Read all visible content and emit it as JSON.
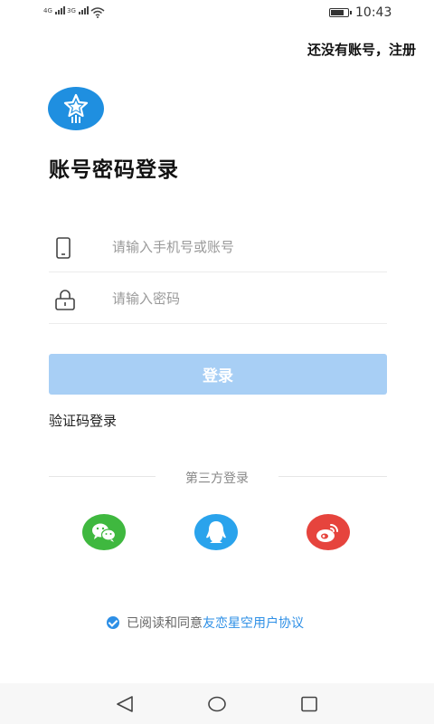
{
  "status_bar": {
    "signal1_label": "4G",
    "signal2_label": "3G",
    "time": "10:43",
    "battery_level": 0.8
  },
  "header": {
    "register_link": "还没有账号，注册"
  },
  "logo": {
    "icon": "star-rocket-icon",
    "color": "#1f8fe0"
  },
  "page_title": "账号密码登录",
  "form": {
    "phone_placeholder": "请输入手机号或账号",
    "password_placeholder": "请输入密码"
  },
  "login_button": "登录",
  "sms_login_link": "验证码登录",
  "third_party": {
    "label": "第三方登录",
    "providers": [
      {
        "name": "wechat-icon",
        "color": "#3fb83f"
      },
      {
        "name": "qq-icon",
        "color": "#2aa3ec"
      },
      {
        "name": "weibo-icon",
        "color": "#e6443d"
      }
    ]
  },
  "agreement": {
    "prefix": "已阅读和同意",
    "link": "友恋星空用户协议",
    "checked": true
  },
  "nav_bar": {
    "back": "back-triangle-icon",
    "home": "home-circle-icon",
    "recents": "recents-square-icon"
  }
}
